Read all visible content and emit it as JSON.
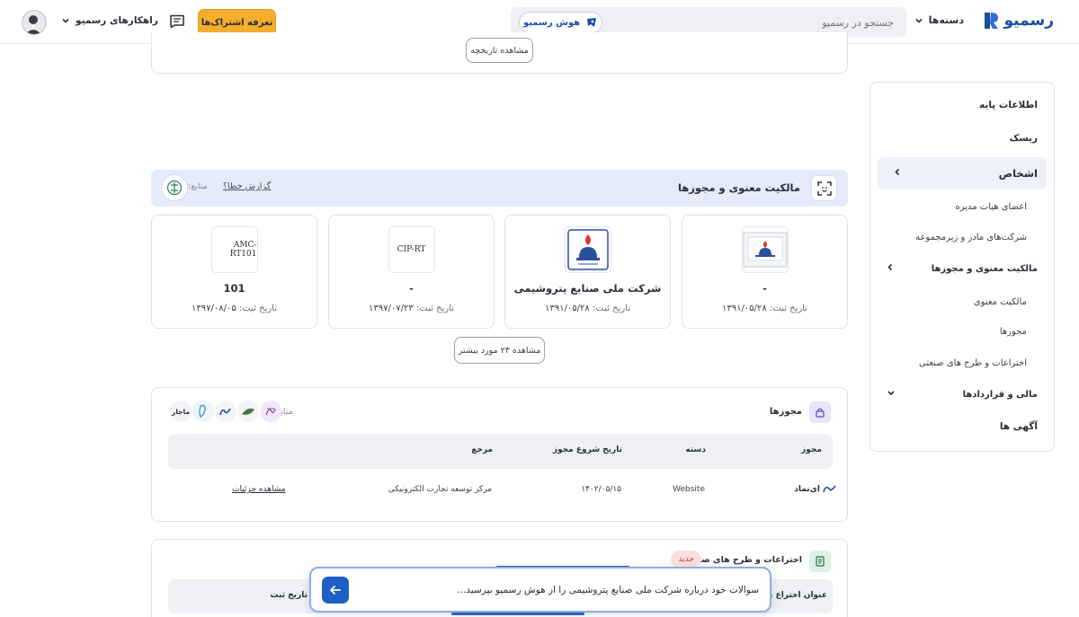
{
  "header": {
    "logo_text": "رسمیو",
    "categories_label": "دسته‌ها",
    "search_placeholder": "جستجو در رسمیو",
    "ai_button_label": "هوش رسمیو",
    "subscription_button_label": "تعرفه اشتراک‌ها",
    "solutions_label": "راهکارهای رسمیو",
    "accent_color": "#1c4fa0",
    "subscription_color": "#f5ad2e"
  },
  "sidebar": {
    "items": [
      {
        "label": "اطلاعات پایه"
      },
      {
        "label": "ریسک"
      },
      {
        "label": "اشخاص",
        "active": true
      },
      {
        "label": "اعضای هیات مدیره"
      },
      {
        "label": "شرکت‌های مادر و زیرمجموعه"
      },
      {
        "label": "مالکیت معنوی و مجوزها"
      },
      {
        "label": "مالکیت معنوی"
      },
      {
        "label": "مجوزها"
      },
      {
        "label": "اختراعات و طرح های صنعتی"
      },
      {
        "label": "مالی و قراردادها"
      },
      {
        "label": "آگهی ها"
      }
    ]
  },
  "history_button_label": "مشاهده تاریخچه",
  "ip_section": {
    "title": "مالکیت معنوی و مجوزها",
    "report_error_label": "گزارش خطا؟",
    "sources_label": "منابع:",
    "cards": [
      {
        "name": "-",
        "date_label": "تاریخ ثبت:",
        "date": "۱۳۹۱/۰۵/۲۸",
        "thumb_text": ""
      },
      {
        "name": "شرکت ملی صنایع پتروشیمی",
        "date_label": "تاریخ ثبت:",
        "date": "۱۳۹۱/۰۵/۲۸",
        "thumb_text": ""
      },
      {
        "name": "-",
        "date_label": "تاریخ ثبت:",
        "date": "۱۳۹۷/۰۷/۲۳",
        "thumb_text": "CIP-RT"
      },
      {
        "name": "101",
        "date_label": "تاریخ ثبت:",
        "date": "۱۳۹۷/۰۸/۰۵",
        "thumb_text": "AMC-RT101"
      }
    ],
    "more_button_label": "مشاهده ۲۳ مورد بیشتر"
  },
  "licenses": {
    "title": "مجوزها",
    "sources_label": "منابع:",
    "source_logos": [
      "ماجار",
      "",
      "",
      "",
      ""
    ],
    "columns": [
      "مجوز",
      "دسته",
      "تاریخ شروع مجوز",
      "مرجع"
    ],
    "rows": [
      {
        "license": "ای‌نماد",
        "category": "Website",
        "start_date": "۱۴۰۲/۰۵/۱۵",
        "authority": "مرکز توسعه تجارت الکترونیکی",
        "details_link": "مشاهده جزئیات"
      }
    ]
  },
  "inventions": {
    "title": "اختراعات و طرح های صنعتی",
    "badge": "جدید",
    "columns": [
      "عنوان اختراع یا",
      "تاریخ ثبت"
    ]
  },
  "ask_bar": {
    "placeholder": "سوالات خود درباره شرکت ملی صنایع پتروشیمی را از هوش رسمیو بپرسید..."
  }
}
